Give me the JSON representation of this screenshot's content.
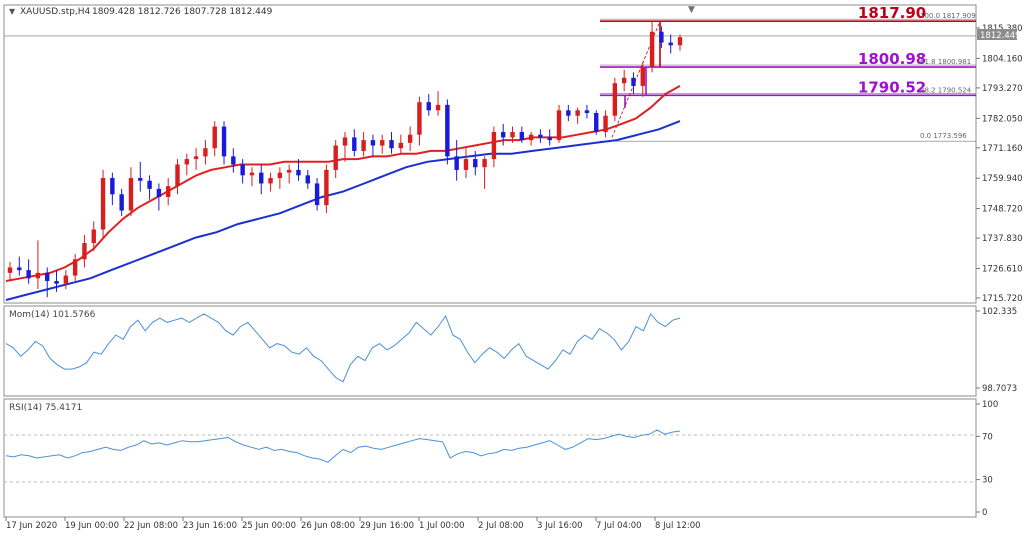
{
  "header": {
    "symbol": "XAUUSD.stp,H4",
    "ohlc": "1809.428 1812.726 1807.728 1812.449"
  },
  "current_price_tag": "1812.449",
  "colors": {
    "bull": "#d81e1e",
    "bear": "#1a1adb",
    "ma_fast": "#e02020",
    "ma_slow": "#1c2fd0",
    "fib_top": "#c0001a",
    "fib_mid": "#a010d0",
    "osc": "#4a90d9",
    "grid": "#b8b8b8"
  },
  "chart_data": [
    {
      "type": "line",
      "title": "XAUUSD.stp,H4",
      "y_ticks": [
        "1815.380",
        "1804.160",
        "1793.270",
        "1782.050",
        "1771.160",
        "1759.940",
        "1748.720",
        "1737.830",
        "1726.610",
        "1715.720"
      ],
      "ylim": [
        1715.72,
        1815.38
      ],
      "x_ticks": [
        "17 Jun 2020",
        "19 Jun 00:00",
        "22 Jun 08:00",
        "23 Jun 16:00",
        "25 Jun 00:00",
        "26 Jun 08:00",
        "29 Jun 16:00",
        "1 Jul 00:00",
        "2 Jul 08:00",
        "3 Jul 16:00",
        "7 Jul 04:00",
        "8 Jul 12:00"
      ],
      "candles": [
        [
          1725,
          1729,
          1722,
          1727
        ],
        [
          1727,
          1731,
          1724,
          1726
        ],
        [
          1726,
          1730,
          1721,
          1723
        ],
        [
          1723,
          1737,
          1719,
          1725
        ],
        [
          1725,
          1727,
          1716,
          1722
        ],
        [
          1722,
          1726,
          1718,
          1721
        ],
        [
          1721,
          1726,
          1719,
          1724
        ],
        [
          1724,
          1732,
          1722,
          1730
        ],
        [
          1730,
          1739,
          1727,
          1736
        ],
        [
          1736,
          1744,
          1733,
          1741
        ],
        [
          1741,
          1763,
          1738,
          1760
        ],
        [
          1760,
          1762,
          1750,
          1754
        ],
        [
          1754,
          1756,
          1746,
          1748
        ],
        [
          1748,
          1764,
          1746,
          1760
        ],
        [
          1760,
          1766,
          1755,
          1759
        ],
        [
          1759,
          1761,
          1752,
          1756
        ],
        [
          1756,
          1758,
          1748,
          1753
        ],
        [
          1753,
          1760,
          1750,
          1757
        ],
        [
          1757,
          1767,
          1754,
          1765
        ],
        [
          1765,
          1769,
          1761,
          1767
        ],
        [
          1767,
          1771,
          1763,
          1768
        ],
        [
          1768,
          1774,
          1765,
          1771
        ],
        [
          1771,
          1781,
          1768,
          1779
        ],
        [
          1779,
          1781,
          1765,
          1768
        ],
        [
          1768,
          1771,
          1762,
          1765
        ],
        [
          1765,
          1767,
          1758,
          1761
        ],
        [
          1761,
          1764,
          1757,
          1762
        ],
        [
          1762,
          1765,
          1754,
          1758
        ],
        [
          1758,
          1762,
          1755,
          1760
        ],
        [
          1760,
          1764,
          1756,
          1762
        ],
        [
          1762,
          1765,
          1758,
          1763
        ],
        [
          1763,
          1767,
          1759,
          1761
        ],
        [
          1761,
          1763,
          1756,
          1758
        ],
        [
          1758,
          1760,
          1748,
          1750
        ],
        [
          1750,
          1765,
          1747,
          1763
        ],
        [
          1763,
          1774,
          1760,
          1772
        ],
        [
          1772,
          1777,
          1766,
          1775
        ],
        [
          1775,
          1778,
          1768,
          1770
        ],
        [
          1770,
          1777,
          1768,
          1774
        ],
        [
          1774,
          1776,
          1768,
          1772
        ],
        [
          1772,
          1776,
          1769,
          1774
        ],
        [
          1774,
          1777,
          1769,
          1771
        ],
        [
          1771,
          1776,
          1769,
          1773
        ],
        [
          1773,
          1779,
          1770,
          1776
        ],
        [
          1776,
          1790,
          1772,
          1788
        ],
        [
          1788,
          1791,
          1783,
          1785
        ],
        [
          1785,
          1792,
          1783,
          1787
        ],
        [
          1787,
          1789,
          1765,
          1768
        ],
        [
          1768,
          1774,
          1759,
          1763
        ],
        [
          1763,
          1771,
          1760,
          1767
        ],
        [
          1767,
          1770,
          1761,
          1764
        ],
        [
          1764,
          1768,
          1756,
          1767
        ],
        [
          1767,
          1779,
          1764,
          1777
        ],
        [
          1777,
          1780,
          1772,
          1775
        ],
        [
          1775,
          1779,
          1773,
          1777
        ],
        [
          1777,
          1779,
          1773,
          1774
        ],
        [
          1774,
          1777,
          1772,
          1776
        ],
        [
          1776,
          1778,
          1773,
          1775
        ],
        [
          1775,
          1778,
          1772,
          1774
        ],
        [
          1774,
          1787,
          1773,
          1785
        ],
        [
          1785,
          1787,
          1781,
          1783
        ],
        [
          1783,
          1786,
          1780,
          1785
        ],
        [
          1785,
          1787,
          1782,
          1784
        ],
        [
          1784,
          1785,
          1776,
          1777
        ],
        [
          1777,
          1785,
          1775,
          1783
        ],
        [
          1783,
          1797,
          1781,
          1795
        ],
        [
          1795,
          1800,
          1792,
          1797
        ],
        [
          1797,
          1799,
          1791,
          1794
        ],
        [
          1794,
          1803,
          1790,
          1801
        ],
        [
          1801,
          1818,
          1799,
          1814
        ],
        [
          1814,
          1816,
          1808,
          1810
        ],
        [
          1810,
          1813,
          1806,
          1809
        ],
        [
          1809,
          1813,
          1807,
          1812
        ]
      ],
      "series": [
        {
          "name": "",
          "values": [
            1722,
            1723,
            1724,
            1725,
            1727,
            1730,
            1734,
            1740,
            1745,
            1749,
            1752,
            1755,
            1758,
            1761,
            1763,
            1764,
            1765,
            1765,
            1765,
            1766,
            1766,
            1766,
            1766,
            1767,
            1767,
            1768,
            1768,
            1769,
            1769,
            1770,
            1770,
            1771,
            1772,
            1773,
            1774,
            1774,
            1775,
            1775,
            1775,
            1776,
            1777,
            1778,
            1780,
            1782,
            1786,
            1791,
            1794
          ]
        },
        {
          "name": "",
          "values": [
            1715,
            1717,
            1719,
            1721,
            1723,
            1726,
            1729,
            1732,
            1735,
            1738,
            1740,
            1743,
            1745,
            1747,
            1750,
            1753,
            1755,
            1758,
            1761,
            1764,
            1766,
            1767,
            1768,
            1769,
            1769,
            1770,
            1771,
            1772,
            1773,
            1774,
            1776,
            1778,
            1781
          ]
        }
      ],
      "fib_levels": [
        {
          "label": "1817.90",
          "sub": "100.0 1817.909",
          "value": 1817.9
        },
        {
          "label": "1800.98",
          "sub": "61.8 1800.981",
          "value": 1800.98
        },
        {
          "label": "1790.52",
          "sub": "38.2 1790.524",
          "value": 1790.52
        },
        {
          "label": "",
          "sub": "0.0 1773.596",
          "value": 1773.6
        }
      ]
    },
    {
      "type": "line",
      "title": "Mom(14) 101.5766",
      "y_ticks": [
        "102.335",
        "98.7073"
      ],
      "ylim": [
        98.7073,
        102.335
      ],
      "series": [
        {
          "name": "Mom(14)",
          "values": [
            100.8,
            100.6,
            100.2,
            100.5,
            100.9,
            100.7,
            100.1,
            99.8,
            99.6,
            99.6,
            99.7,
            99.9,
            100.4,
            100.3,
            100.8,
            101.2,
            101.0,
            101.6,
            101.9,
            101.4,
            101.8,
            102.0,
            101.8,
            101.9,
            102.0,
            101.8,
            102.0,
            102.2,
            102.0,
            101.8,
            101.4,
            101.2,
            101.6,
            101.8,
            101.4,
            101.0,
            100.6,
            100.8,
            100.7,
            100.4,
            100.3,
            100.6,
            100.2,
            100.0,
            99.6,
            99.2,
            99.0,
            99.8,
            100.2,
            100.0,
            100.6,
            100.8,
            100.5,
            100.7,
            101.0,
            101.3,
            101.8,
            101.5,
            101.2,
            101.6,
            102.1,
            101.2,
            101.0,
            100.4,
            99.9,
            100.3,
            100.6,
            100.4,
            100.1,
            100.5,
            100.8,
            100.2,
            100.0,
            99.8,
            99.6,
            100.0,
            100.5,
            100.3,
            100.9,
            101.2,
            101.0,
            101.5,
            101.3,
            101.0,
            100.5,
            100.9,
            101.6,
            101.4,
            102.2,
            101.8,
            101.6,
            101.9,
            102.0
          ]
        }
      ]
    },
    {
      "type": "line",
      "title": "RSI(14) 75.4171",
      "y_ticks": [
        "100",
        "70",
        "30",
        "0"
      ],
      "ylim": [
        0,
        100
      ],
      "series": [
        {
          "name": "RSI(14)",
          "values": [
            52,
            51,
            53,
            52,
            50,
            51,
            52,
            53,
            50,
            52,
            55,
            56,
            58,
            60,
            58,
            57,
            60,
            62,
            66,
            63,
            64,
            62,
            64,
            66,
            65,
            65,
            66,
            67,
            68,
            69,
            65,
            62,
            60,
            58,
            60,
            57,
            58,
            56,
            55,
            52,
            50,
            49,
            46,
            52,
            58,
            55,
            60,
            61,
            59,
            58,
            60,
            62,
            64,
            66,
            68,
            67,
            66,
            65,
            50,
            54,
            56,
            55,
            52,
            54,
            55,
            58,
            57,
            59,
            60,
            62,
            64,
            66,
            62,
            58,
            60,
            64,
            68,
            67,
            68,
            70,
            72,
            70,
            69,
            71,
            72,
            76,
            72,
            74,
            75
          ]
        }
      ]
    }
  ]
}
